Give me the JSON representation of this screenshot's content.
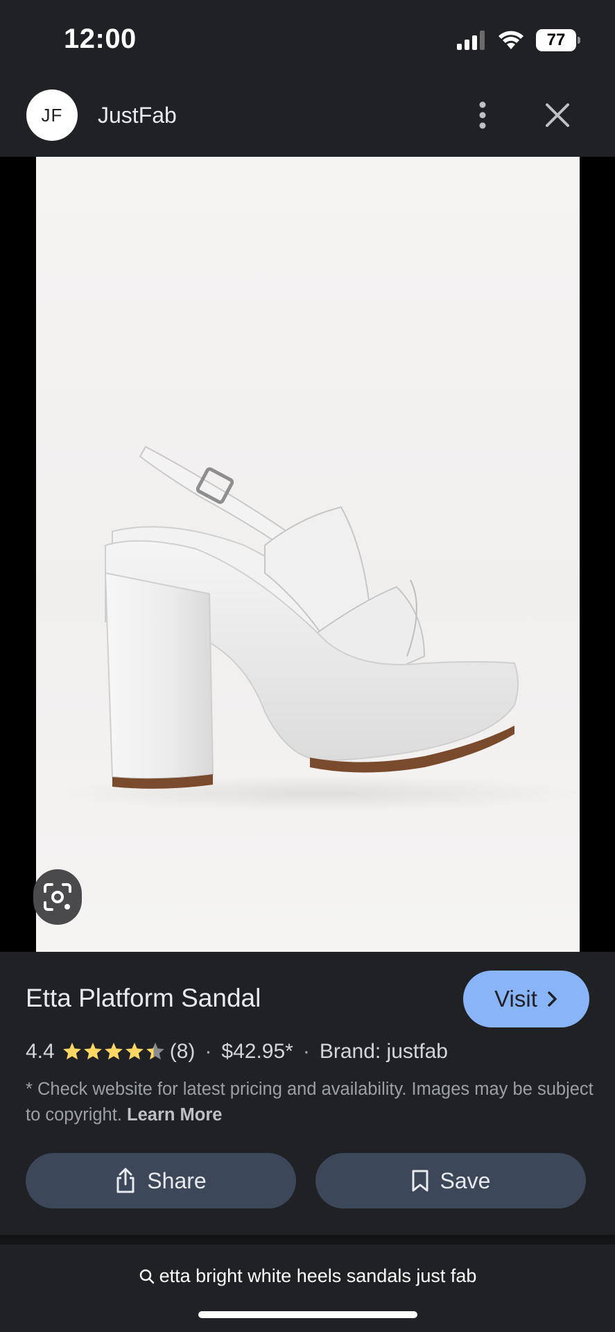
{
  "status_bar": {
    "time": "12:00",
    "battery": "77",
    "icons": [
      "signal-icon",
      "wifi-icon",
      "battery-icon"
    ]
  },
  "header": {
    "avatar_initials": "JF",
    "site_name": "JustFab",
    "icons": [
      "more-vertical-icon",
      "close-icon"
    ]
  },
  "image": {
    "subject": "white patent platform sandal with chunky block heel and buckle slingback strap",
    "lens_icon": "google-lens-icon"
  },
  "product": {
    "title": "Etta Platform Sandal",
    "visit_label": "Visit",
    "rating": "4.4",
    "rating_value": 4.4,
    "rating_max": 5,
    "review_count": "(8)",
    "price": "$42.95*",
    "brand": "Brand: justfab",
    "disclaimer": "* Check website for latest pricing and availability. Images may be subject to copyright.",
    "learn_more": "Learn More"
  },
  "actions": {
    "share_label": "Share",
    "save_label": "Save"
  },
  "search": {
    "query": "etta bright white heels sandals just fab"
  },
  "colors": {
    "background": "#202124",
    "accent_visit": "#8ab4f8",
    "action_button": "#3c4759",
    "star": "#fdd663"
  }
}
